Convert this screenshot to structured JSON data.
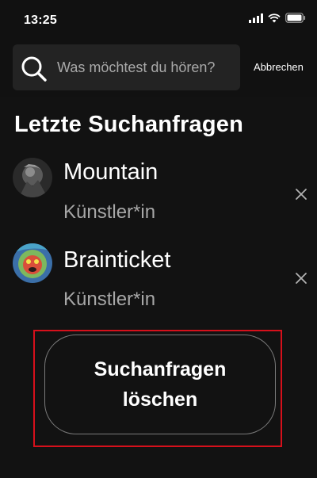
{
  "status_bar": {
    "time": "13:25",
    "icons": [
      "cellular-signal-icon",
      "wifi-icon",
      "battery-icon"
    ]
  },
  "search": {
    "placeholder": "Was möchtest du hören?",
    "value": "",
    "cancel_label": "Abbrechen",
    "icon": "search-icon"
  },
  "recent": {
    "title": "Letzte Suchanfragen",
    "items": [
      {
        "name": "Mountain",
        "type": "Künstler*in",
        "remove_icon": "close-icon"
      },
      {
        "name": "Brainticket",
        "type": "Künstler*in",
        "remove_icon": "close-icon"
      }
    ],
    "clear_label": "Suchanfragen löschen"
  },
  "colors": {
    "background": "#121212",
    "search_box": "#232323",
    "secondary_text": "#a7a7a7",
    "highlight": "#d6101b"
  }
}
